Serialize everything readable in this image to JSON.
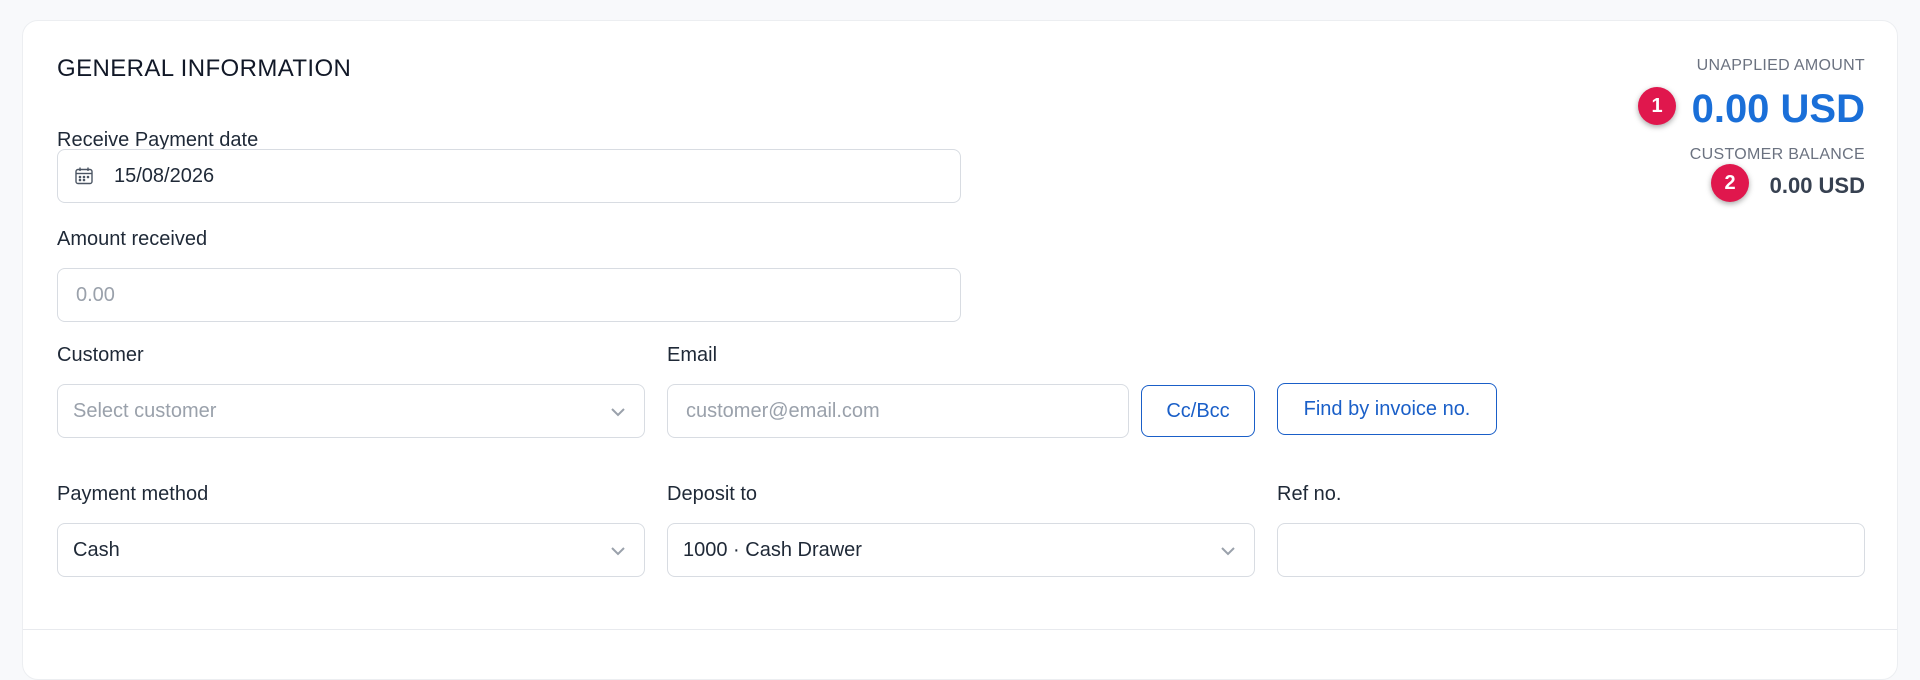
{
  "section": {
    "title": "GENERAL INFORMATION"
  },
  "payment_date": {
    "label": "Receive Payment date",
    "value": "15/08/2026",
    "icon": "calendar-icon"
  },
  "amount_received": {
    "label": "Amount received",
    "placeholder": "0.00"
  },
  "customer": {
    "label": "Customer",
    "placeholder": "Select customer"
  },
  "email": {
    "label": "Email",
    "placeholder": "customer@email.com"
  },
  "buttons": {
    "cc_bcc": "Cc/Bcc",
    "find_invoice": "Find by invoice no."
  },
  "payment_method": {
    "label": "Payment method",
    "value": "Cash"
  },
  "deposit_to": {
    "label": "Deposit to",
    "value": "1000 · Cash Drawer"
  },
  "ref_no": {
    "label": "Ref no.",
    "value": ""
  },
  "summary": {
    "unapplied_label": "UNAPPLIED AMOUNT",
    "unapplied_value": "0.00 USD",
    "balance_label": "CUSTOMER BALANCE",
    "balance_value": "0.00 USD",
    "badge1": "1",
    "badge2": "2"
  },
  "colors": {
    "accent": "#1a5fc8",
    "amount": "#1a6fd8",
    "badge": "#e0174d"
  }
}
